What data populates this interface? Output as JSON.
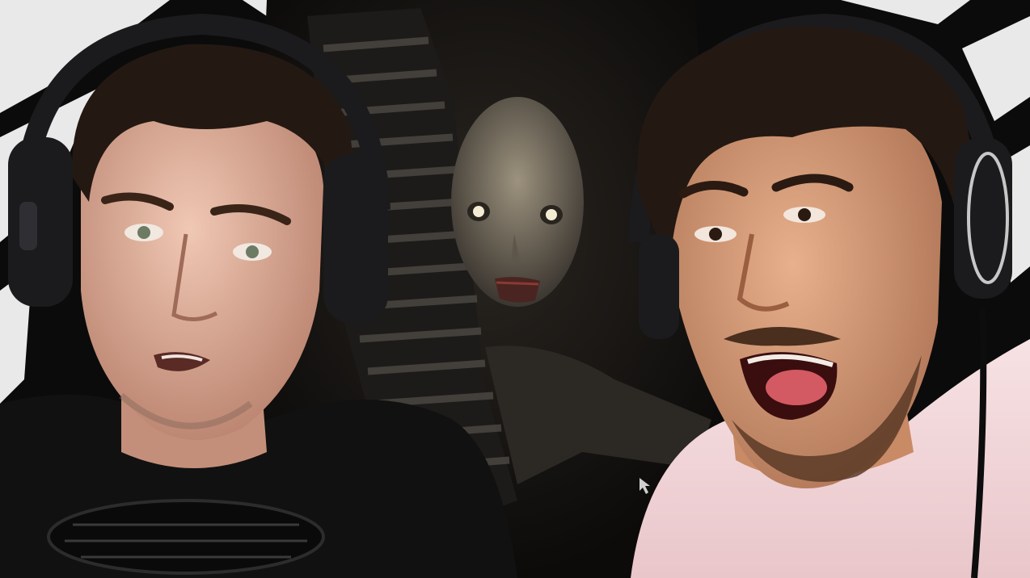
{
  "image": {
    "kind": "video-thumbnail",
    "colors": {
      "stripe_light": "#e9e9e9",
      "stripe_dark": "#0b0b0b",
      "scene_dark": "#1a1714",
      "creature_face": "#8a8170",
      "creature_eye": "#f3ecd2",
      "left_shirt": "#111111",
      "right_shirt": "#f2d6da",
      "skin_left": "#e0b39d",
      "skin_right": "#d59a78",
      "hair": "#241812",
      "headphone": "#1b1b1d"
    },
    "figures": [
      "left-reacting-person",
      "right-screaming-person",
      "horror-creature",
      "striped-figure"
    ],
    "icons": [
      "mouse-cursor-icon"
    ]
  }
}
